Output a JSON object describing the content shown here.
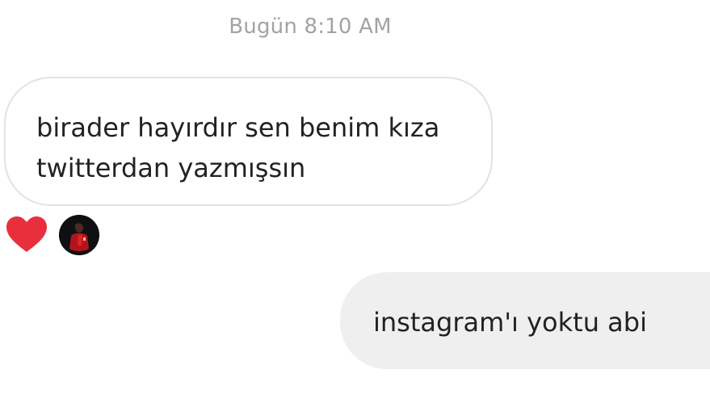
{
  "conversation": {
    "timestamp": "Bugün 8:10 AM",
    "incoming_message": {
      "text": "birader hayırdır sen benim kıza\ntwitterdan yazmışsın",
      "reaction": "heart-icon",
      "reaction_color": "#e8303c"
    },
    "outgoing_message": {
      "text": "instagram'ı yoktu abi"
    }
  },
  "colors": {
    "timestamp": "#a3a3a3",
    "incoming_border": "#e2e2e2",
    "outgoing_bubble": "#efefef",
    "text": "#222222"
  }
}
